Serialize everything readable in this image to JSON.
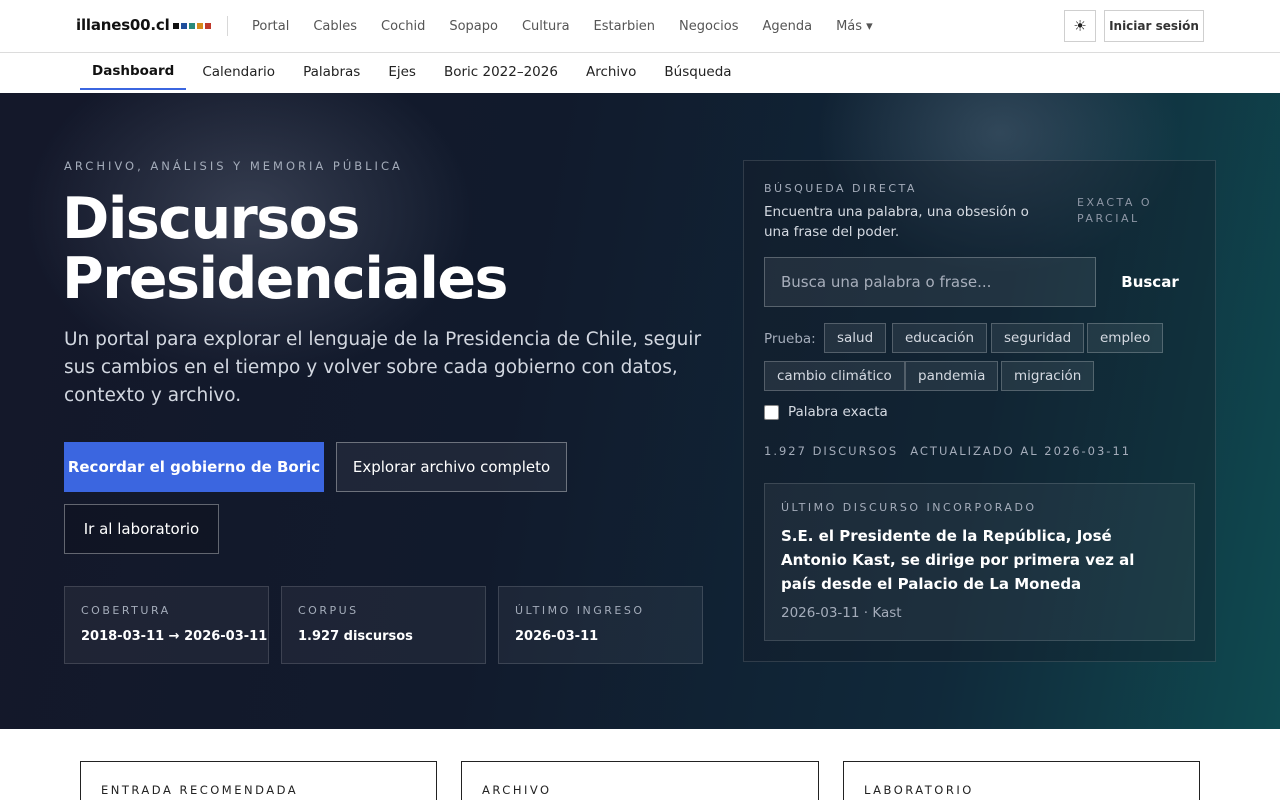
{
  "brand": {
    "name": "illanes00.cl",
    "squares": [
      "#111111",
      "#1f4e9c",
      "#2a8a7a",
      "#d88a1a",
      "#c0392b"
    ]
  },
  "topnav": {
    "items": [
      "Portal",
      "Cables",
      "Cochid",
      "Sopapo",
      "Cultura",
      "Estarbien",
      "Negocios",
      "Agenda"
    ],
    "more": "Más ▾"
  },
  "header": {
    "theme_icon": "☀",
    "login": "Iniciar sesión"
  },
  "subnav": {
    "tabs": [
      "Dashboard",
      "Calendario",
      "Palabras",
      "Ejes",
      "Boric 2022–2026",
      "Archivo",
      "Búsqueda"
    ],
    "active": "Dashboard"
  },
  "hero": {
    "eyebrow": "ARCHIVO, ANÁLISIS Y MEMORIA PÚBLICA",
    "title_line1": "Discursos",
    "title_line2": "Presidenciales",
    "subtitle": "Un portal para explorar el lenguaje de la Presidencia de Chile, seguir sus cambios en el tiempo y volver sobre cada gobierno con datos, contexto y archivo.",
    "cta_primary": "Recordar el gobierno de Boric",
    "cta_archive": "Explorar archivo completo",
    "cta_lab": "Ir al laboratorio",
    "stats": [
      {
        "label": "COBERTURA",
        "value": "2018-03-11 → 2026-03-11"
      },
      {
        "label": "CORPUS",
        "value": "1.927 discursos"
      },
      {
        "label": "ÚLTIMO INGRESO",
        "value": "2026-03-11"
      }
    ]
  },
  "search": {
    "eyebrow": "BÚSQUEDA DIRECTA",
    "description": "Encuentra una palabra, una obsesión o una frase del poder.",
    "mode": "EXACTA O PARCIAL",
    "placeholder": "Busca una palabra o frase...",
    "button": "Buscar",
    "try_label": "Prueba:",
    "chips": [
      "salud",
      "educación",
      "seguridad",
      "empleo",
      "cambio climático",
      "pandemia",
      "migración"
    ],
    "exact_label": "Palabra exacta",
    "exact_checked": false,
    "meta_count": "1.927 DISCURSOS",
    "meta_updated": "ACTUALIZADO AL 2026-03-11"
  },
  "latest": {
    "eyebrow": "ÚLTIMO DISCURSO INCORPORADO",
    "title": "S.E. el Presidente de la República, José Antonio Kast, se dirige por primera vez al país desde el Palacio de La Moneda",
    "meta": "2026-03-11 · Kast"
  },
  "cards": [
    {
      "label": "ENTRADA RECOMENDADA"
    },
    {
      "label": "ARCHIVO"
    },
    {
      "label": "LABORATORIO"
    }
  ]
}
